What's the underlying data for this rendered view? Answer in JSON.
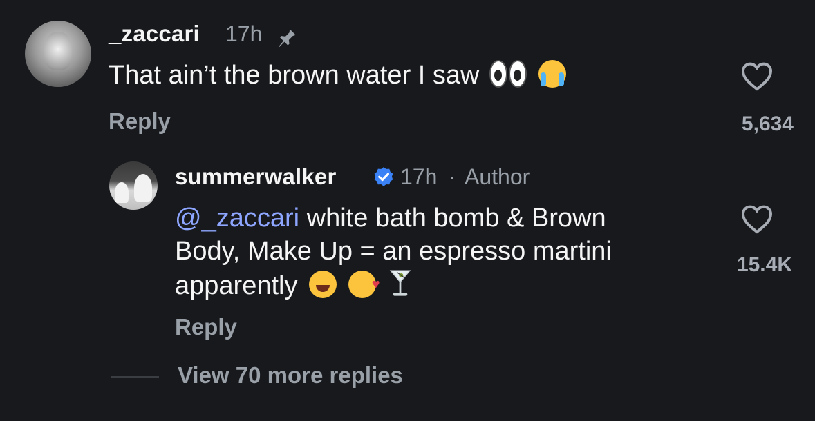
{
  "comment": {
    "username": "_zaccari",
    "time": "17h",
    "text": "That ain’t the brown water I saw",
    "emojis": [
      "eyes-emoji",
      "crying-face-emoji"
    ],
    "reply_label": "Reply",
    "likes": "5,634"
  },
  "reply_comment": {
    "username": "summerwalker",
    "verified": true,
    "time": "17h",
    "separator": "·",
    "author_tag": "Author",
    "mention": "@_zaccari",
    "line1": " white bath bomb & Brown",
    "line2": "Body, Make Up = an espresso martini",
    "line3": "apparently",
    "emojis": [
      "tears-of-joy-emoji",
      "smiling-face-with-hearts-emoji",
      "cocktail-glass-emoji"
    ],
    "reply_label": "Reply",
    "likes": "15.4K"
  },
  "thread": {
    "more_replies": "View 70 more replies"
  },
  "colors": {
    "background": "#17191d",
    "mention": "#8ea6ff",
    "verified": "#3b82f6",
    "muted": "#9aa0a8"
  }
}
